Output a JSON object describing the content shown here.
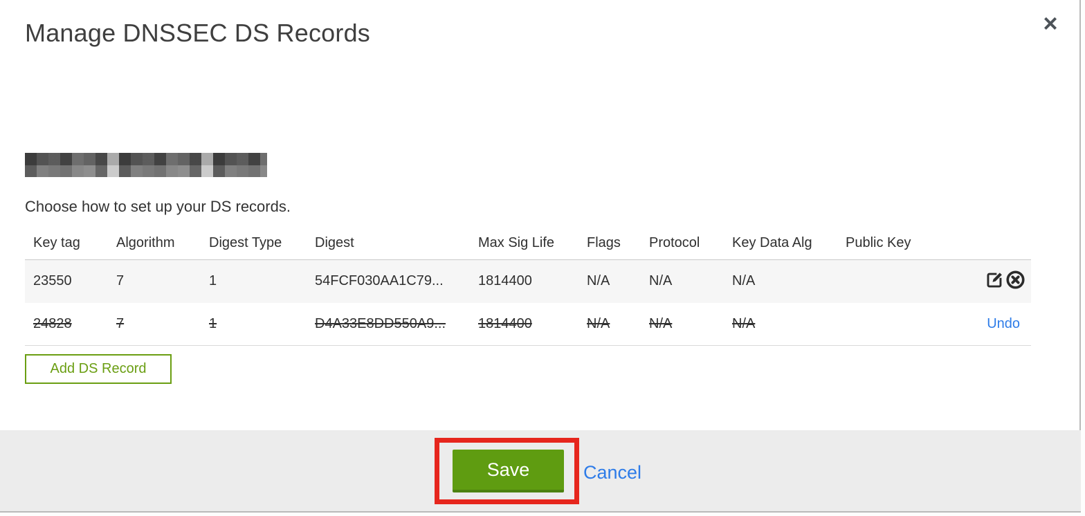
{
  "modal": {
    "title": "Manage DNSSEC DS Records",
    "close_glyph": "×",
    "instruction": "Choose how to set up your DS records."
  },
  "table": {
    "columns": [
      "Key tag",
      "Algorithm",
      "Digest Type",
      "Digest",
      "Max Sig Life",
      "Flags",
      "Protocol",
      "Key Data Alg",
      "Public Key"
    ],
    "rows": [
      {
        "key_tag": "23550",
        "algorithm": "7",
        "digest_type": "1",
        "digest": "54FCF030AA1C79...",
        "max_sig_life": "1814400",
        "flags": "N/A",
        "protocol": "N/A",
        "key_data_alg": "N/A",
        "public_key": "",
        "state": "active"
      },
      {
        "key_tag": "24828",
        "algorithm": "7",
        "digest_type": "1",
        "digest": "D4A33E8DD550A9...",
        "max_sig_life": "1814400",
        "flags": "N/A",
        "protocol": "N/A",
        "key_data_alg": "N/A",
        "public_key": "",
        "state": "marked-for-deletion",
        "undo_label": "Undo"
      }
    ]
  },
  "actions": {
    "add_ds_record_label": "Add DS Record",
    "save_label": "Save",
    "cancel_label": "Cancel"
  },
  "colors": {
    "green_button_bg": "#5f9c11",
    "green_button_border_bottom": "#4c8110",
    "green_outline_button": "#6a9e12",
    "link_blue": "#2e7ce8",
    "annotation_red": "#e6261d",
    "footer_bg": "#ececec",
    "active_row_bg": "#f6f6f6"
  }
}
